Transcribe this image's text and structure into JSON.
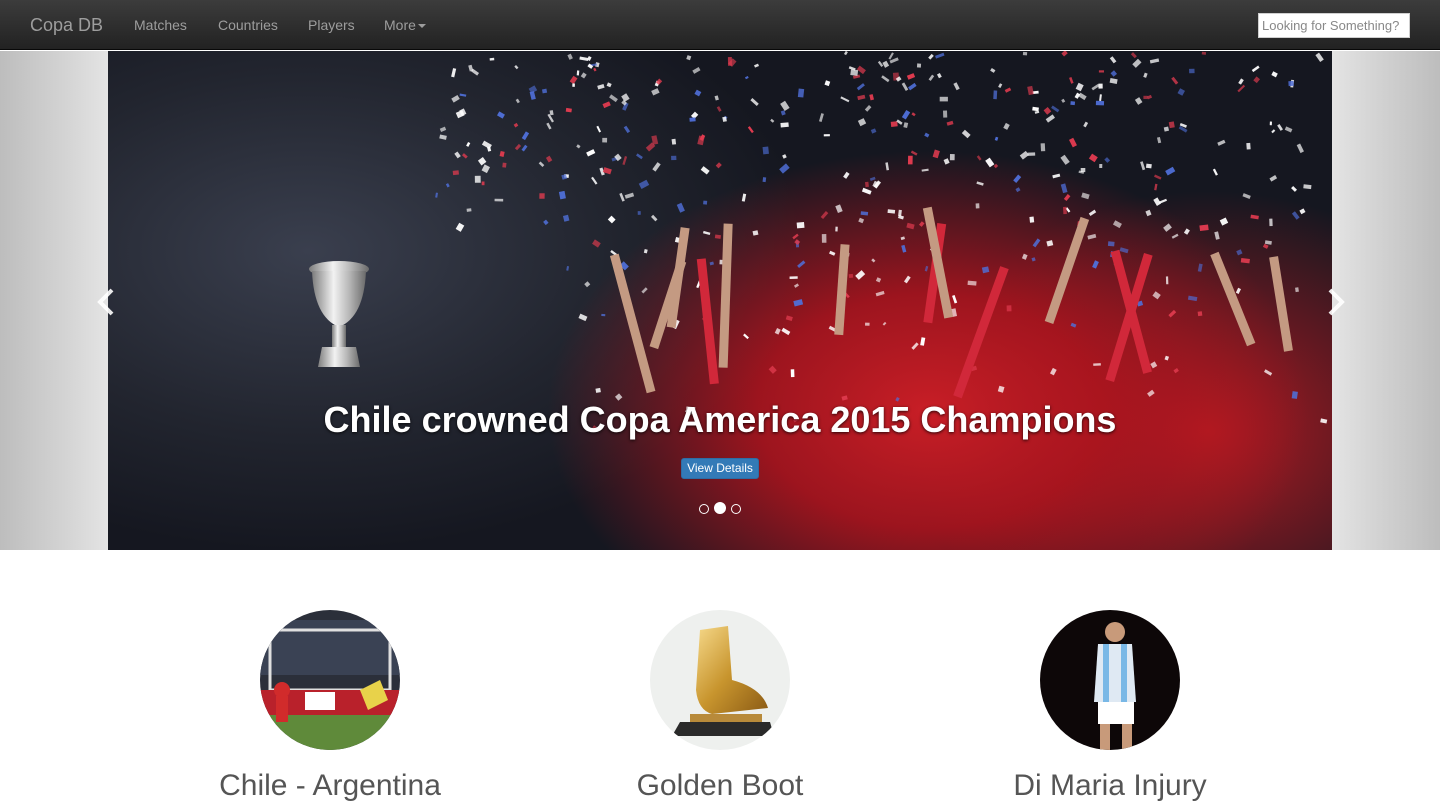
{
  "navbar": {
    "brand": "Copa DB",
    "links": [
      "Matches",
      "Countries",
      "Players",
      "More"
    ],
    "search_placeholder": "Looking for Something?"
  },
  "carousel": {
    "caption": "Chile crowned Copa America 2015 Champions",
    "button_label": "View Details",
    "indicator_count": 3,
    "active_index": 1
  },
  "features": [
    {
      "title": "Chile - Argentina"
    },
    {
      "title": "Golden Boot"
    },
    {
      "title": "Di Maria Injury"
    }
  ],
  "colors": {
    "navbar": "#222222",
    "nav_text": "#9d9d9d",
    "button": "#337ab7",
    "jersey_red": "#c81e26",
    "heading": "#555555"
  }
}
